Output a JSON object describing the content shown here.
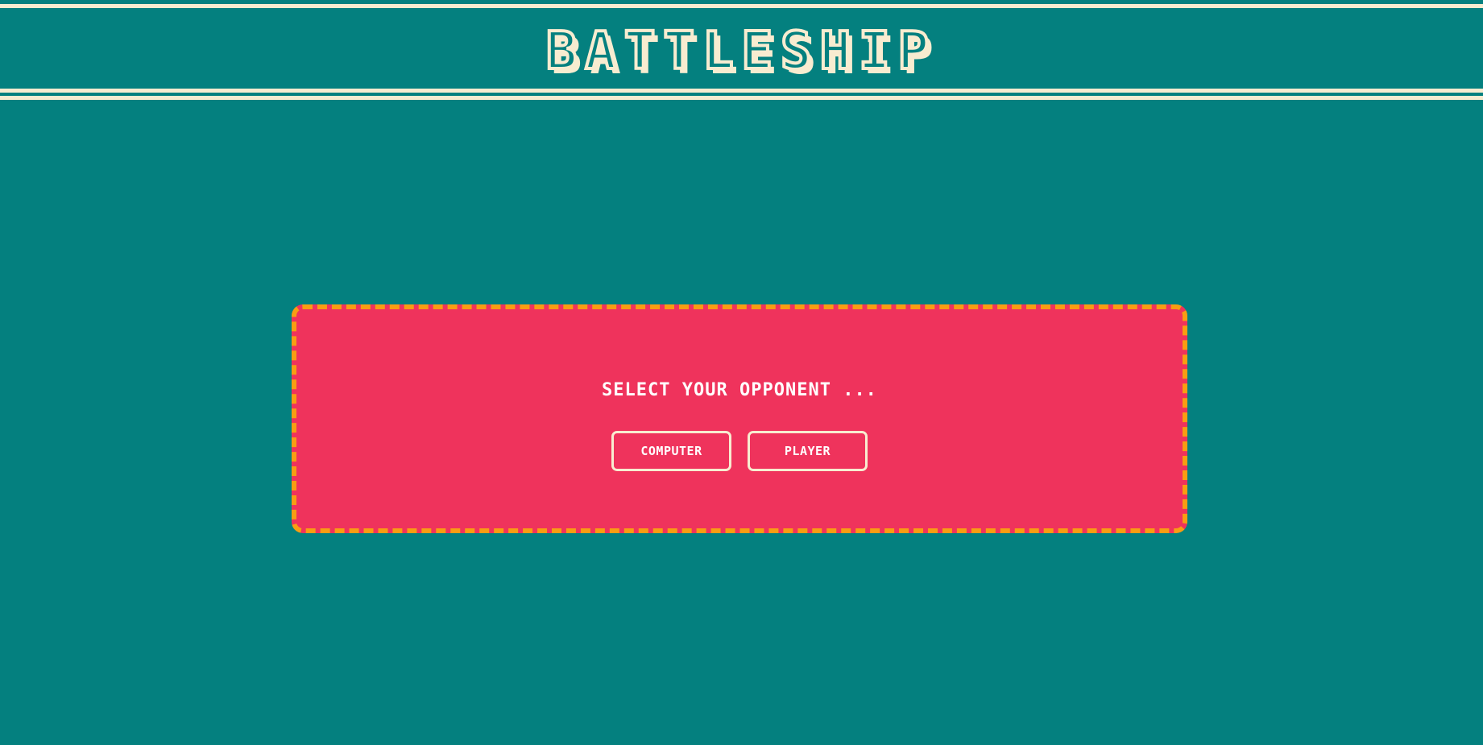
{
  "header": {
    "title": "BATTLESHIP"
  },
  "modal": {
    "prompt": "SELECT YOUR OPPONENT ...",
    "buttons": {
      "computer": "COMPUTER",
      "player": "PLAYER"
    }
  },
  "colors": {
    "background": "#04807f",
    "cream": "#f8ecd0",
    "modal_fill": "#ef335c",
    "modal_border": "#f89d13",
    "text": "#ffffff"
  }
}
